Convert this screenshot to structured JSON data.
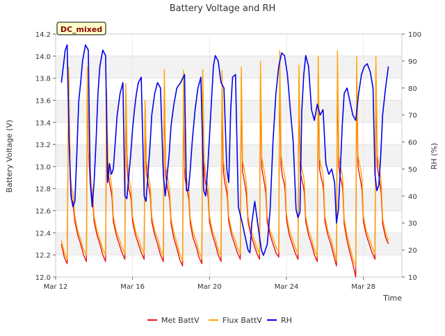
{
  "chart_data": {
    "type": "line",
    "title": "Battery Voltage and RH",
    "xlabel": "Time",
    "ylabel_left": "Battery Voltage (V)",
    "ylabel_right": "RH (%)",
    "site_label": "DC_mixed",
    "x_ticks": [
      {
        "day": 12,
        "label": "Mar 12"
      },
      {
        "day": 16,
        "label": "Mar 16"
      },
      {
        "day": 20,
        "label": "Mar 20"
      },
      {
        "day": 24,
        "label": "Mar 24"
      },
      {
        "day": 28,
        "label": "Mar 28"
      }
    ],
    "xlim": [
      12.0,
      30.0
    ],
    "ylim_left": [
      12.0,
      14.2
    ],
    "yticks_left": [
      "12.0",
      "12.2",
      "12.4",
      "12.6",
      "12.8",
      "13.0",
      "13.2",
      "13.4",
      "13.6",
      "13.8",
      "14.0",
      "14.2"
    ],
    "ylim_right": [
      10,
      100
    ],
    "yticks_right": [
      "10",
      "20",
      "30",
      "40",
      "50",
      "60",
      "70",
      "80",
      "90",
      "100"
    ],
    "grid_bands": true,
    "legend_position": "bottom-center",
    "series": [
      {
        "name": "Met BattV",
        "axis": "left",
        "color": "#ee1111",
        "x": [
          12.3,
          12.45,
          12.6,
          12.68,
          12.76,
          12.84,
          12.9,
          13.0,
          13.15,
          13.3,
          13.45,
          13.6,
          13.65,
          13.72,
          13.8,
          13.88,
          13.93,
          14.0,
          14.15,
          14.3,
          14.45,
          14.6,
          14.65,
          14.72,
          14.8,
          14.88,
          14.93,
          15.0,
          15.15,
          15.3,
          15.45,
          15.6,
          15.65,
          15.72,
          15.8,
          15.88,
          15.93,
          16.0,
          16.15,
          16.3,
          16.45,
          16.6,
          16.65,
          16.72,
          16.8,
          16.88,
          16.93,
          17.0,
          17.15,
          17.3,
          17.45,
          17.6,
          17.65,
          17.72,
          17.8,
          17.88,
          17.93,
          18.0,
          18.15,
          18.3,
          18.45,
          18.6,
          18.65,
          18.72,
          18.8,
          18.88,
          18.93,
          19.0,
          19.15,
          19.3,
          19.45,
          19.6,
          19.65,
          19.72,
          19.8,
          19.88,
          19.93,
          20.0,
          20.15,
          20.3,
          20.45,
          20.6,
          20.65,
          20.72,
          20.8,
          20.88,
          20.93,
          21.0,
          21.15,
          21.3,
          21.45,
          21.6,
          21.65,
          21.72,
          21.8,
          21.88,
          21.93,
          22.0,
          22.15,
          22.3,
          22.45,
          22.6,
          22.65,
          22.72,
          22.8,
          22.88,
          22.93,
          23.0,
          23.15,
          23.3,
          23.45,
          23.6,
          23.65,
          23.72,
          23.8,
          23.88,
          23.93,
          24.0,
          24.15,
          24.3,
          24.45,
          24.6,
          24.65,
          24.72,
          24.8,
          24.88,
          24.93,
          25.0,
          25.15,
          25.3,
          25.45,
          25.6,
          25.65,
          25.72,
          25.8,
          25.88,
          25.93,
          26.0,
          26.15,
          26.3,
          26.45,
          26.6,
          26.65,
          26.72,
          26.8,
          26.88,
          26.93,
          27.0,
          27.15,
          27.3,
          27.45,
          27.6,
          27.65,
          27.72,
          27.8,
          27.88,
          27.93,
          28.0,
          28.15,
          28.3,
          28.45,
          28.6,
          28.65,
          28.72,
          28.8,
          28.88,
          28.93,
          29.0,
          29.15,
          29.3
        ],
        "y": [
          12.3,
          12.18,
          12.12,
          13.85,
          12.9,
          12.7,
          12.68,
          12.5,
          12.38,
          12.3,
          12.2,
          12.14,
          13.8,
          13.1,
          12.85,
          12.75,
          12.7,
          12.5,
          12.38,
          12.3,
          12.2,
          12.14,
          13.6,
          12.95,
          12.85,
          12.78,
          12.72,
          12.5,
          12.38,
          12.3,
          12.22,
          12.16,
          13.65,
          13.0,
          12.8,
          12.75,
          12.7,
          12.5,
          12.38,
          12.3,
          12.22,
          12.16,
          13.5,
          12.95,
          12.85,
          12.78,
          12.72,
          12.5,
          12.38,
          12.3,
          12.2,
          12.14,
          13.78,
          12.92,
          12.82,
          12.75,
          12.7,
          12.48,
          12.35,
          12.26,
          12.16,
          12.1,
          13.7,
          12.9,
          12.82,
          12.75,
          12.7,
          12.48,
          12.35,
          12.28,
          12.18,
          12.12,
          13.8,
          12.95,
          12.85,
          12.78,
          12.72,
          12.5,
          12.38,
          12.3,
          12.2,
          12.14,
          13.6,
          12.95,
          12.85,
          12.78,
          12.72,
          12.5,
          12.38,
          12.3,
          12.22,
          12.16,
          13.8,
          12.95,
          12.88,
          12.8,
          12.72,
          12.5,
          12.38,
          12.3,
          12.22,
          12.16,
          13.8,
          12.98,
          12.9,
          12.82,
          12.75,
          12.5,
          12.38,
          12.3,
          12.22,
          12.18,
          13.85,
          13.0,
          12.9,
          12.85,
          12.78,
          12.52,
          12.38,
          12.3,
          12.22,
          12.16,
          13.8,
          12.95,
          12.88,
          12.82,
          12.76,
          12.5,
          12.38,
          12.3,
          12.2,
          12.14,
          13.82,
          12.98,
          12.9,
          12.85,
          12.78,
          12.5,
          12.38,
          12.3,
          12.2,
          12.1,
          13.85,
          13.0,
          12.9,
          12.85,
          12.78,
          12.48,
          12.33,
          12.22,
          12.12,
          12.0,
          13.82,
          13.0,
          12.92,
          12.85,
          12.78,
          12.5,
          12.38,
          12.3,
          12.22,
          12.16,
          13.88,
          13.0,
          12.92,
          12.82,
          12.75,
          12.48,
          12.36,
          12.3
        ]
      },
      {
        "name": "Flux BattV",
        "axis": "left",
        "color": "#ffa500",
        "x": [
          12.3,
          12.45,
          12.6,
          12.68,
          12.76,
          12.84,
          12.9,
          13.0,
          13.15,
          13.3,
          13.45,
          13.6,
          13.65,
          13.72,
          13.8,
          13.88,
          13.93,
          14.0,
          14.15,
          14.3,
          14.45,
          14.6,
          14.65,
          14.72,
          14.8,
          14.88,
          14.93,
          15.0,
          15.15,
          15.3,
          15.45,
          15.6,
          15.65,
          15.72,
          15.8,
          15.88,
          15.93,
          16.0,
          16.15,
          16.3,
          16.45,
          16.6,
          16.65,
          16.72,
          16.8,
          16.88,
          16.93,
          17.0,
          17.15,
          17.3,
          17.45,
          17.6,
          17.65,
          17.72,
          17.8,
          17.88,
          17.93,
          18.0,
          18.15,
          18.3,
          18.45,
          18.6,
          18.65,
          18.72,
          18.8,
          18.88,
          18.93,
          19.0,
          19.15,
          19.3,
          19.45,
          19.6,
          19.65,
          19.72,
          19.8,
          19.88,
          19.93,
          20.0,
          20.15,
          20.3,
          20.45,
          20.6,
          20.65,
          20.72,
          20.8,
          20.88,
          20.93,
          21.0,
          21.15,
          21.3,
          21.45,
          21.6,
          21.65,
          21.72,
          21.8,
          21.88,
          21.93,
          22.0,
          22.15,
          22.3,
          22.45,
          22.6,
          22.65,
          22.72,
          22.8,
          22.88,
          22.93,
          23.0,
          23.15,
          23.3,
          23.45,
          23.6,
          23.65,
          23.72,
          23.8,
          23.88,
          23.93,
          24.0,
          24.15,
          24.3,
          24.45,
          24.6,
          24.65,
          24.72,
          24.8,
          24.88,
          24.93,
          25.0,
          25.15,
          25.3,
          25.45,
          25.6,
          25.65,
          25.72,
          25.8,
          25.88,
          25.93,
          26.0,
          26.15,
          26.3,
          26.45,
          26.6,
          26.65,
          26.72,
          26.8,
          26.88,
          26.93,
          27.0,
          27.15,
          27.3,
          27.45,
          27.6,
          27.65,
          27.72,
          27.8,
          27.88,
          27.93,
          28.0,
          28.15,
          28.3,
          28.45,
          28.6,
          28.65,
          28.72,
          28.8,
          28.88,
          28.93,
          29.0,
          29.15,
          29.3
        ],
        "y": [
          12.33,
          12.22,
          12.16,
          13.9,
          12.95,
          12.8,
          12.76,
          12.55,
          12.42,
          12.34,
          12.25,
          12.2,
          13.9,
          13.15,
          12.95,
          12.82,
          12.78,
          12.55,
          12.42,
          12.34,
          12.25,
          12.2,
          13.7,
          13.05,
          12.95,
          12.86,
          12.8,
          12.55,
          12.42,
          12.35,
          12.27,
          12.21,
          13.75,
          13.1,
          12.9,
          12.84,
          12.78,
          12.55,
          12.42,
          12.35,
          12.27,
          12.21,
          13.6,
          13.05,
          12.95,
          12.86,
          12.8,
          12.55,
          12.42,
          12.35,
          12.25,
          12.19,
          13.88,
          13.0,
          12.92,
          12.84,
          12.78,
          12.53,
          12.4,
          12.31,
          12.21,
          12.15,
          13.87,
          13.0,
          12.9,
          12.83,
          12.78,
          12.53,
          12.4,
          12.33,
          12.23,
          12.17,
          13.88,
          13.05,
          12.95,
          12.86,
          12.8,
          12.55,
          12.42,
          12.35,
          12.25,
          12.19,
          13.87,
          13.05,
          12.95,
          12.86,
          12.8,
          12.55,
          12.42,
          12.35,
          12.27,
          12.21,
          13.9,
          13.05,
          12.98,
          12.9,
          12.82,
          12.55,
          12.42,
          12.35,
          12.27,
          12.21,
          13.95,
          13.08,
          13.0,
          12.92,
          12.85,
          12.55,
          12.42,
          12.35,
          12.27,
          12.23,
          14.05,
          13.1,
          13.0,
          12.95,
          12.88,
          12.57,
          12.42,
          12.35,
          12.27,
          12.21,
          13.92,
          13.05,
          12.98,
          12.92,
          12.86,
          12.55,
          12.42,
          12.35,
          12.25,
          12.19,
          14.0,
          13.08,
          13.0,
          12.95,
          12.88,
          12.55,
          12.42,
          12.35,
          12.25,
          12.15,
          14.05,
          13.1,
          13.0,
          12.95,
          12.88,
          12.53,
          12.38,
          12.27,
          12.17,
          12.1,
          14.0,
          13.1,
          13.02,
          12.95,
          12.88,
          12.55,
          12.42,
          12.35,
          12.27,
          12.21,
          14.0,
          13.1,
          13.02,
          12.92,
          12.85,
          12.53,
          12.4,
          12.33
        ]
      },
      {
        "name": "RH",
        "axis": "right",
        "color": "#0000ee",
        "x": [
          12.3,
          12.5,
          12.6,
          12.7,
          12.8,
          12.9,
          13.0,
          13.1,
          13.2,
          13.3,
          13.4,
          13.55,
          13.7,
          13.8,
          13.9,
          14.0,
          14.1,
          14.2,
          14.3,
          14.45,
          14.6,
          14.7,
          14.8,
          14.9,
          15.0,
          15.1,
          15.2,
          15.35,
          15.5,
          15.6,
          15.7,
          15.8,
          15.9,
          16.0,
          16.1,
          16.2,
          16.3,
          16.45,
          16.6,
          16.7,
          16.8,
          16.9,
          17.0,
          17.15,
          17.3,
          17.45,
          17.6,
          17.7,
          17.8,
          17.9,
          18.0,
          18.15,
          18.3,
          18.5,
          18.7,
          18.8,
          18.9,
          19.0,
          19.1,
          19.25,
          19.4,
          19.55,
          19.7,
          19.8,
          19.9,
          20.0,
          20.1,
          20.2,
          20.3,
          20.45,
          20.6,
          20.75,
          20.9,
          21.0,
          21.1,
          21.2,
          21.35,
          21.5,
          21.7,
          21.85,
          22.0,
          22.1,
          22.2,
          22.35,
          22.5,
          22.7,
          22.8,
          22.9,
          23.0,
          23.15,
          23.3,
          23.45,
          23.6,
          23.75,
          23.9,
          24.05,
          24.2,
          24.35,
          24.5,
          24.6,
          24.7,
          24.8,
          24.9,
          25.0,
          25.15,
          25.3,
          25.45,
          25.6,
          25.75,
          25.9,
          26.05,
          26.2,
          26.35,
          26.5,
          26.6,
          26.7,
          26.8,
          26.9,
          27.0,
          27.15,
          27.3,
          27.45,
          27.6,
          27.75,
          27.9,
          28.05,
          28.2,
          28.35,
          28.5,
          28.6,
          28.7,
          28.8,
          28.9,
          29.0,
          29.15,
          29.3
        ],
        "y": [
          82,
          94,
          96,
          60,
          40,
          36,
          38,
          55,
          75,
          82,
          90,
          96,
          94,
          45,
          36,
          45,
          60,
          78,
          88,
          94,
          92,
          45,
          52,
          48,
          50,
          60,
          70,
          78,
          82,
          40,
          39,
          47,
          55,
          65,
          72,
          78,
          82,
          84,
          40,
          38,
          48,
          58,
          70,
          78,
          82,
          80,
          48,
          40,
          48,
          55,
          66,
          74,
          80,
          82,
          85,
          42,
          42,
          50,
          60,
          72,
          80,
          84,
          42,
          40,
          50,
          62,
          75,
          88,
          92,
          90,
          82,
          80,
          50,
          45,
          72,
          84,
          85,
          36,
          30,
          25,
          20,
          19,
          30,
          38,
          30,
          20,
          18,
          20,
          22,
          35,
          60,
          78,
          88,
          93,
          92,
          85,
          72,
          60,
          35,
          32,
          34,
          72,
          85,
          92,
          88,
          72,
          68,
          74,
          70,
          72,
          52,
          48,
          50,
          45,
          30,
          35,
          50,
          66,
          78,
          80,
          75,
          70,
          68,
          78,
          85,
          88,
          89,
          86,
          80,
          48,
          42,
          44,
          55,
          70,
          80,
          88
        ]
      }
    ]
  }
}
